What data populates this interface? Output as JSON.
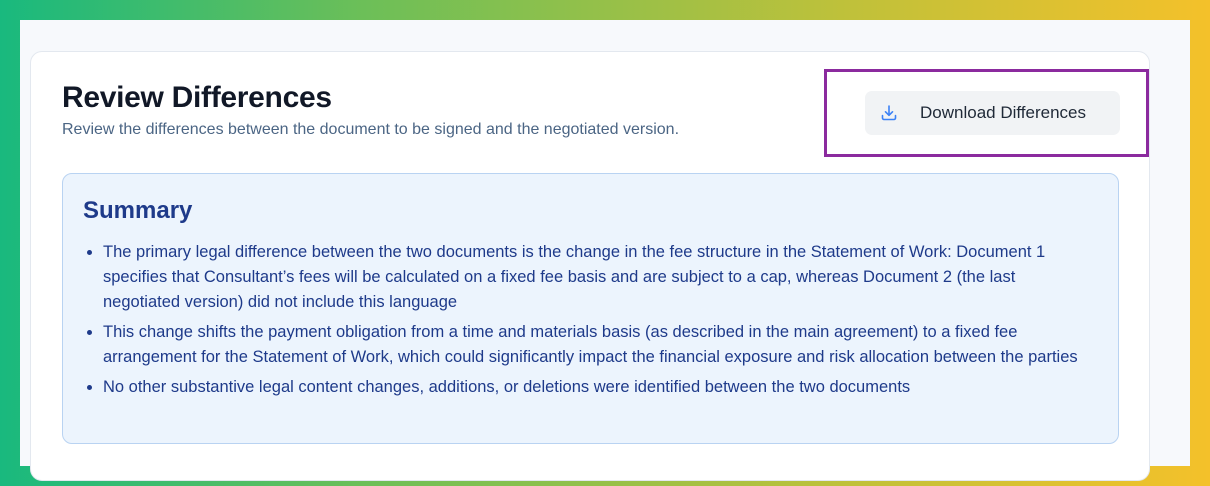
{
  "header": {
    "title": "Review Differences",
    "subtitle": "Review the differences between the document to be signed and the negotiated version."
  },
  "actions": {
    "download_label": "Download Differences",
    "download_icon": "download-icon"
  },
  "summary": {
    "title": "Summary",
    "items": [
      "The primary legal difference between the two documents is the change in the fee structure in the Statement of Work: Document 1 specifies that Consultant’s fees will be calculated on a fixed fee basis and are subject to a cap, whereas Document 2 (the last negotiated version) did not include this language",
      "This change shifts the payment obligation from a time and materials basis (as described in the main agreement) to a fixed fee arrangement for the Statement of Work, which could significantly impact the financial exposure and risk allocation between the parties",
      "No other substantive legal content changes, additions, or deletions were identified between the two documents"
    ]
  },
  "colors": {
    "highlight": "#8b2a9e",
    "summary_bg": "#ecf4fd",
    "summary_text": "#1e3a8a",
    "accent_icon": "#3b82f6"
  }
}
